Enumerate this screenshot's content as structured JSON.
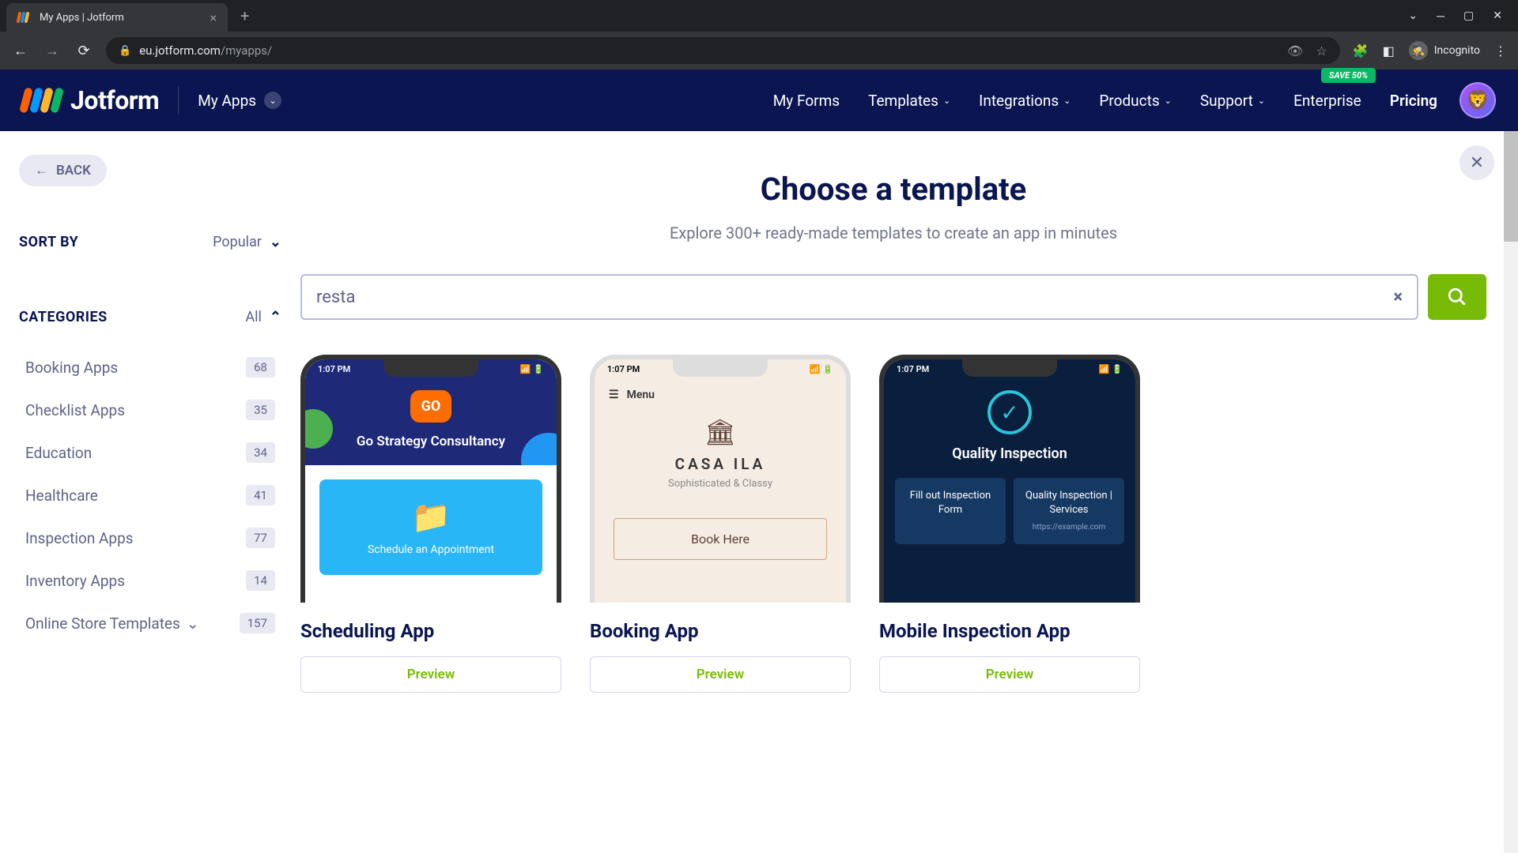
{
  "browser": {
    "tab_title": "My Apps | Jotform",
    "url_domain": "eu.jotform.com",
    "url_path": "/myapps/",
    "incognito_label": "Incognito"
  },
  "header": {
    "logo_text": "Jotform",
    "context": "My Apps",
    "nav": [
      "My Forms",
      "Templates",
      "Integrations",
      "Products",
      "Support",
      "Enterprise",
      "Pricing"
    ],
    "save_badge": "SAVE 50%"
  },
  "page": {
    "back_label": "BACK",
    "title": "Choose a template",
    "subtitle": "Explore 300+ ready-made templates to create an app in minutes",
    "search_value": "resta"
  },
  "sort": {
    "label": "SORT BY",
    "value": "Popular"
  },
  "categories": {
    "label": "CATEGORIES",
    "all_label": "All",
    "items": [
      {
        "name": "Booking Apps",
        "count": "68"
      },
      {
        "name": "Checklist Apps",
        "count": "35"
      },
      {
        "name": "Education",
        "count": "34"
      },
      {
        "name": "Healthcare",
        "count": "41"
      },
      {
        "name": "Inspection Apps",
        "count": "77"
      },
      {
        "name": "Inventory Apps",
        "count": "14"
      },
      {
        "name": "Online Store Templates",
        "count": "157",
        "has_sub": true
      }
    ]
  },
  "templates": [
    {
      "name": "Scheduling App",
      "preview_label": "Preview",
      "phone_time": "1:07 PM",
      "t1_logo": "GO",
      "t1_title": "Go Strategy Consultancy",
      "t1_card_text": "Schedule an Appointment"
    },
    {
      "name": "Booking App",
      "preview_label": "Preview",
      "phone_time": "1:07 PM",
      "t2_menu": "Menu",
      "t2_name": "CASA ILA",
      "t2_tagline": "Sophisticated & Classy",
      "t2_btn": "Book Here"
    },
    {
      "name": "Mobile Inspection App",
      "preview_label": "Preview",
      "phone_time": "1:07 PM",
      "t3_title": "Quality Inspection",
      "t3_card1": "Fill out Inspection Form",
      "t3_card2": "Quality Inspection | Services",
      "t3_card2_sub": "https://example.com"
    }
  ]
}
